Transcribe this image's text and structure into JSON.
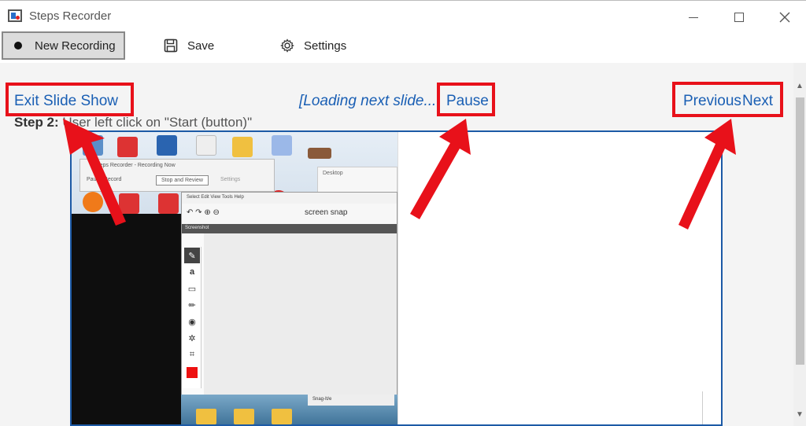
{
  "window": {
    "title": "Steps Recorder",
    "minimize_icon": "minimize-icon",
    "maximize_icon": "maximize-icon",
    "close_icon": "close-icon"
  },
  "toolbar": {
    "new_recording_label": "New Recording",
    "save_label": "Save",
    "settings_label": "Settings"
  },
  "slideshow": {
    "exit_label": "Exit Slide Show",
    "loading_text": "[Loading next slide...",
    "pause_label": "Pause",
    "previous_label": "Previous",
    "next_label": "Next",
    "step_number": "Step 2:",
    "step_text": " User left click on \"Start (button)\""
  },
  "screenshot": {
    "mini_window_title": "Steps Recorder - Recording Now",
    "mini_pause": "Pause Record",
    "mini_stop": "Stop and Review",
    "mini_settings": "Settings",
    "desktop_window_title": "Desktop",
    "snap_menu": "Select   Edit   View   Tools   Help",
    "snap_tool_label": "screen snap",
    "snap_caption": "Screenshot",
    "taskbar_item": "Snag-It/e"
  },
  "colors": {
    "link": "#1a5fb4",
    "annotation_red": "#e8111a",
    "frame_border": "#1c5aa6"
  }
}
